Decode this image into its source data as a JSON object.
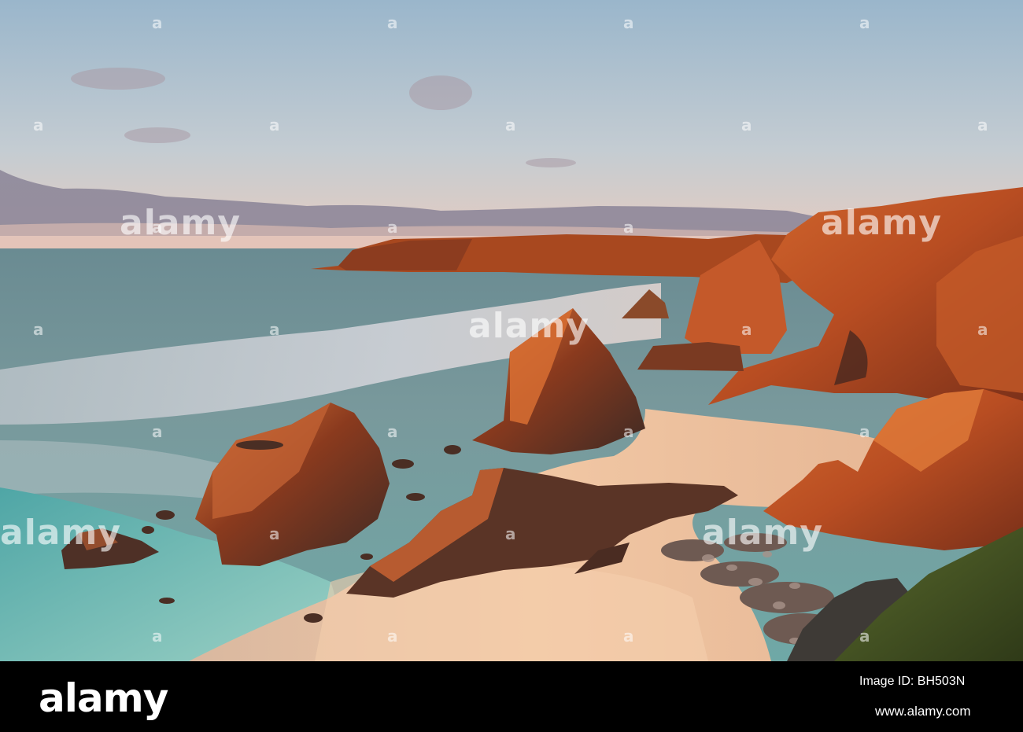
{
  "watermark": {
    "brand": "alamy",
    "mark_glyph": "a"
  },
  "footer": {
    "brand": "alamy",
    "image_id_label": "Image ID: BH503N",
    "url": "www.alamy.com"
  },
  "colors": {
    "sky_top": "#9db8cc",
    "sky_horizon": "#e8c8b8",
    "sea": "#5e8a8e",
    "surf": "#c8d0d6",
    "lagoon": "#5fb0ad",
    "sand": "#e6b898",
    "cliff_lit": "#c8582a",
    "rock_dark": "#4a2e24",
    "grass": "#3e4a22",
    "footer_bg": "#000000"
  }
}
